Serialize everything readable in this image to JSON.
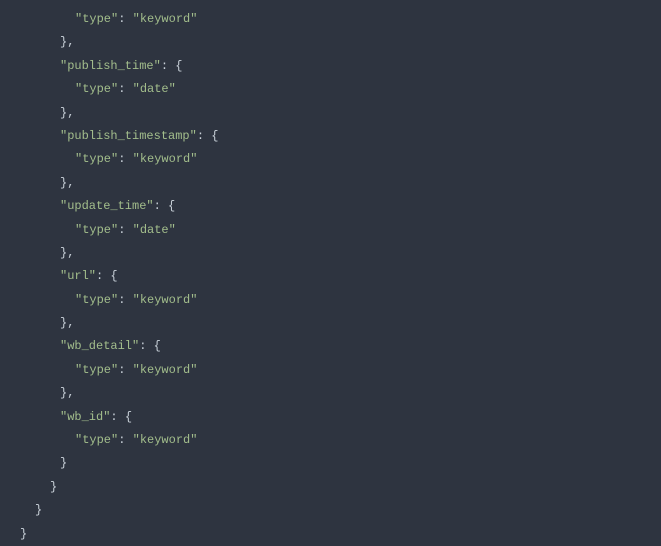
{
  "code": {
    "lines": [
      {
        "indent": 5,
        "tokens": [
          {
            "t": "string",
            "v": "\"type\""
          },
          {
            "t": "punct",
            "v": ": "
          },
          {
            "t": "string",
            "v": "\"keyword\""
          }
        ]
      },
      {
        "indent": 4,
        "tokens": [
          {
            "t": "punct",
            "v": "},"
          }
        ]
      },
      {
        "indent": 4,
        "tokens": [
          {
            "t": "string",
            "v": "\"publish_time\""
          },
          {
            "t": "punct",
            "v": ": {"
          }
        ]
      },
      {
        "indent": 5,
        "tokens": [
          {
            "t": "string",
            "v": "\"type\""
          },
          {
            "t": "punct",
            "v": ": "
          },
          {
            "t": "string",
            "v": "\"date\""
          }
        ]
      },
      {
        "indent": 4,
        "tokens": [
          {
            "t": "punct",
            "v": "},"
          }
        ]
      },
      {
        "indent": 4,
        "tokens": [
          {
            "t": "string",
            "v": "\"publish_timestamp\""
          },
          {
            "t": "punct",
            "v": ": {"
          }
        ]
      },
      {
        "indent": 5,
        "tokens": [
          {
            "t": "string",
            "v": "\"type\""
          },
          {
            "t": "punct",
            "v": ": "
          },
          {
            "t": "string",
            "v": "\"keyword\""
          }
        ]
      },
      {
        "indent": 4,
        "tokens": [
          {
            "t": "punct",
            "v": "},"
          }
        ]
      },
      {
        "indent": 4,
        "tokens": [
          {
            "t": "string",
            "v": "\"update_time\""
          },
          {
            "t": "punct",
            "v": ": {"
          }
        ]
      },
      {
        "indent": 5,
        "tokens": [
          {
            "t": "string",
            "v": "\"type\""
          },
          {
            "t": "punct",
            "v": ": "
          },
          {
            "t": "string",
            "v": "\"date\""
          }
        ]
      },
      {
        "indent": 4,
        "tokens": [
          {
            "t": "punct",
            "v": "},"
          }
        ]
      },
      {
        "indent": 4,
        "tokens": [
          {
            "t": "string",
            "v": "\"url\""
          },
          {
            "t": "punct",
            "v": ": {"
          }
        ]
      },
      {
        "indent": 5,
        "tokens": [
          {
            "t": "string",
            "v": "\"type\""
          },
          {
            "t": "punct",
            "v": ": "
          },
          {
            "t": "string",
            "v": "\"keyword\""
          }
        ]
      },
      {
        "indent": 4,
        "tokens": [
          {
            "t": "punct",
            "v": "},"
          }
        ]
      },
      {
        "indent": 4,
        "tokens": [
          {
            "t": "string",
            "v": "\"wb_detail\""
          },
          {
            "t": "punct",
            "v": ": {"
          }
        ]
      },
      {
        "indent": 5,
        "tokens": [
          {
            "t": "string",
            "v": "\"type\""
          },
          {
            "t": "punct",
            "v": ": "
          },
          {
            "t": "string",
            "v": "\"keyword\""
          }
        ]
      },
      {
        "indent": 4,
        "tokens": [
          {
            "t": "punct",
            "v": "},"
          }
        ]
      },
      {
        "indent": 4,
        "tokens": [
          {
            "t": "string",
            "v": "\"wb_id\""
          },
          {
            "t": "punct",
            "v": ": {"
          }
        ]
      },
      {
        "indent": 5,
        "tokens": [
          {
            "t": "string",
            "v": "\"type\""
          },
          {
            "t": "punct",
            "v": ": "
          },
          {
            "t": "string",
            "v": "\"keyword\""
          }
        ]
      },
      {
        "indent": 4,
        "tokens": [
          {
            "t": "punct",
            "v": "}"
          }
        ]
      },
      {
        "indent": 3,
        "tokens": [
          {
            "t": "punct",
            "v": "}"
          }
        ]
      },
      {
        "indent": 2,
        "tokens": [
          {
            "t": "punct",
            "v": "}"
          }
        ]
      },
      {
        "indent": 1,
        "tokens": [
          {
            "t": "punct",
            "v": "}"
          }
        ]
      }
    ]
  }
}
